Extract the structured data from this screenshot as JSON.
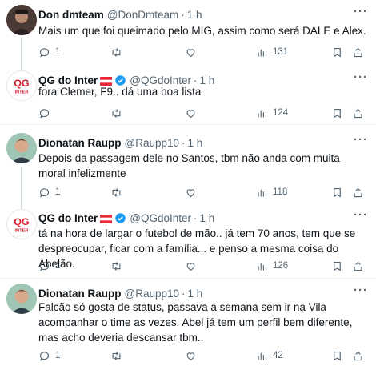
{
  "tweets": [
    {
      "name": "Don dmteam",
      "handle": "@DonDmteam",
      "time": "1 h",
      "text": "Mais um que foi queimado pelo MIG, assim como será DALE e Alex.",
      "replies": "1",
      "retweets": "",
      "likes": "",
      "views": "131"
    },
    {
      "name": "QG do Inter",
      "handle": "@QGdoInter",
      "time": "1 h",
      "text": "fora Clemer, F9.. dá uma boa lista",
      "replies": "",
      "retweets": "",
      "likes": "",
      "views": "124",
      "avatar_text": "QG DO INTER"
    },
    {
      "name": "Dionatan Raupp",
      "handle": "@Raupp10",
      "time": "1 h",
      "text": "Depois da passagem dele no Santos, tbm não anda com muita moral infelizmente",
      "replies": "1",
      "retweets": "",
      "likes": "",
      "views": "118"
    },
    {
      "name": "QG do Inter",
      "handle": "@QGdoInter",
      "time": "1 h",
      "text": "tá na hora de largar o futebol de mão.. já tem 70 anos, tem que se despreocupar, ficar com a família... e penso a mesma coisa do Abelão.",
      "replies": "1",
      "retweets": "",
      "likes": "",
      "views": "126",
      "avatar_text": "QG DO INTER"
    },
    {
      "name": "Dionatan Raupp",
      "handle": "@Raupp10",
      "time": "1 h",
      "text": "Falcão só gosta de status, passava a semana sem ir na Vila acompanhar o time as vezes. Abel já tem um perfil bem diferente, mas acho deveria descansar tbm..",
      "replies": "1",
      "retweets": "",
      "likes": "",
      "views": "42"
    }
  ],
  "colors": {
    "text": "#0f1419",
    "muted": "#536471",
    "verified": "#1d9bf0",
    "inter_red": "#d1202f",
    "separator": "#eff3f4"
  }
}
